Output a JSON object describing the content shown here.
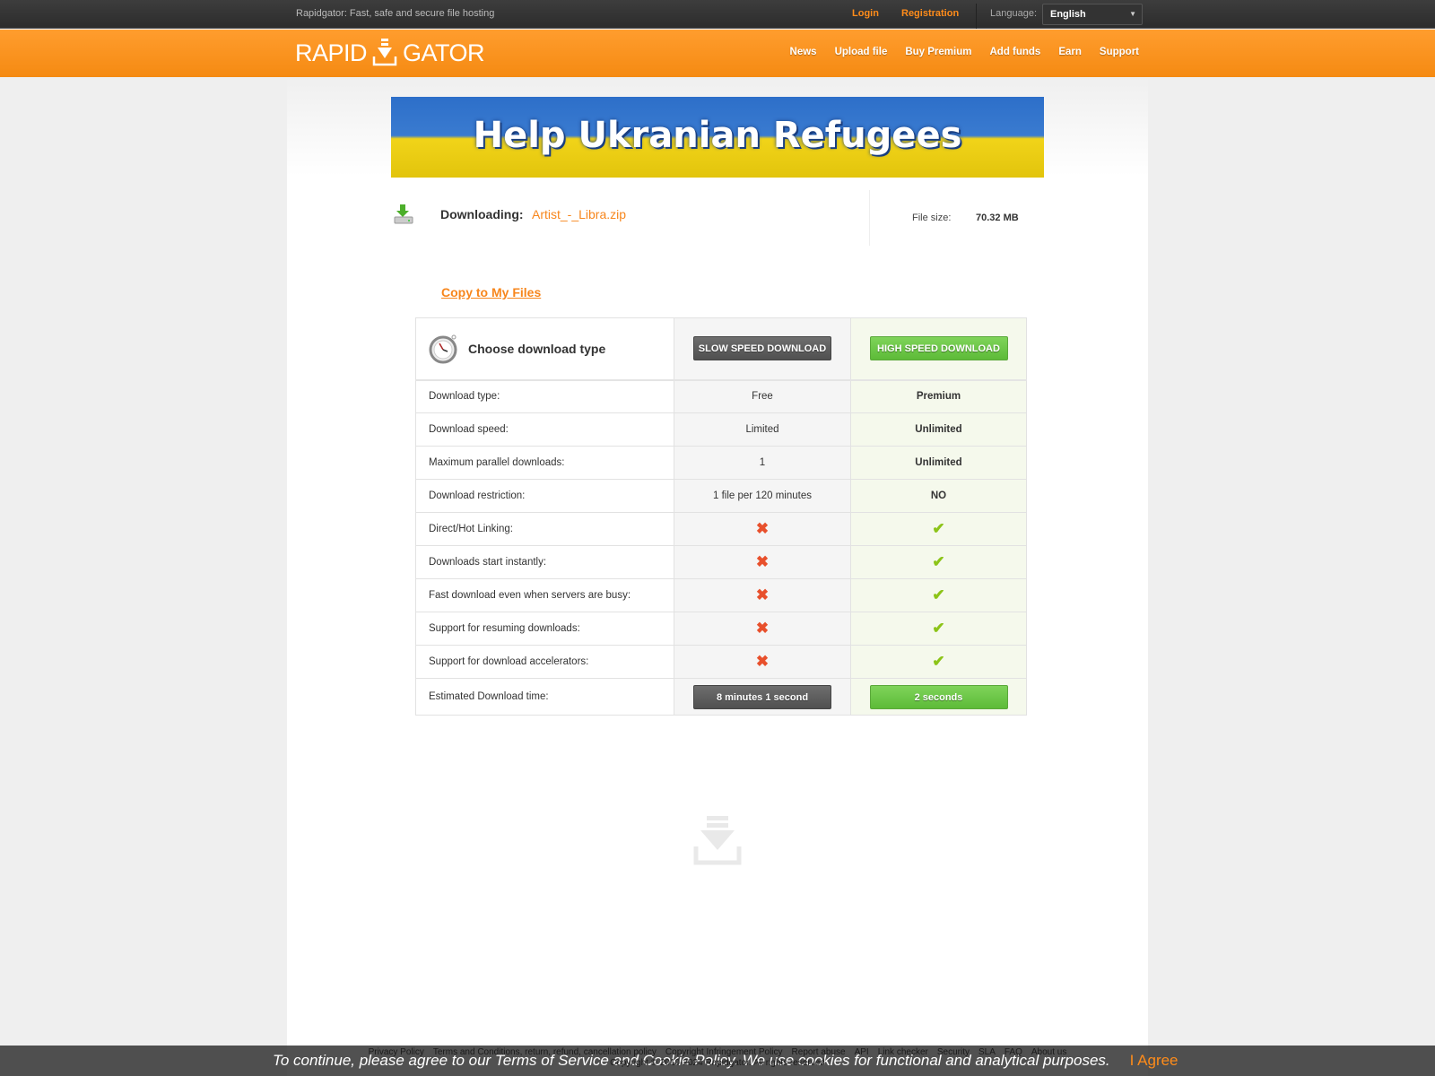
{
  "topbar": {
    "tagline": "Rapidgator: Fast, safe and secure file hosting",
    "login": "Login",
    "registration": "Registration",
    "language_label": "Language:",
    "language_value": "English"
  },
  "header": {
    "logo": "RAPID GATOR",
    "logo_left": "RAPID",
    "logo_right": "GATOR",
    "nav": [
      "News",
      "Upload file",
      "Buy Premium",
      "Add funds",
      "Earn",
      "Support"
    ]
  },
  "banner": {
    "text": "Help Ukranian Refugees"
  },
  "file": {
    "downloading_label": "Downloading:",
    "name": "Artist_-_Libra.zip",
    "size_label": "File size:",
    "size": "70.32 MB"
  },
  "copy_link": "Copy to My Files",
  "table": {
    "title": "Choose download type",
    "slow_button": "SLOW SPEED DOWNLOAD",
    "high_button": "HIGH SPEED DOWNLOAD",
    "rows": [
      {
        "label": "Download type:",
        "free": "Free",
        "premium": "Premium"
      },
      {
        "label": "Download speed:",
        "free": "Limited",
        "premium": "Unlimited"
      },
      {
        "label": "Maximum parallel downloads:",
        "free": "1",
        "premium": "Unlimited"
      },
      {
        "label": "Download restriction:",
        "free": "1 file per 120 minutes",
        "premium": "NO"
      },
      {
        "label": "Direct/Hot Linking:",
        "free": "cross-icon",
        "premium": "check-icon"
      },
      {
        "label": "Downloads start instantly:",
        "free": "cross-icon",
        "premium": "check-icon"
      },
      {
        "label": "Fast download even when servers are busy:",
        "free": "cross-icon",
        "premium": "check-icon"
      },
      {
        "label": "Support for resuming downloads:",
        "free": "cross-icon",
        "premium": "check-icon"
      },
      {
        "label": "Support for download accelerators:",
        "free": "cross-icon",
        "premium": "check-icon"
      }
    ],
    "estimate": {
      "label": "Estimated Download time:",
      "free": "8 minutes 1 second",
      "premium": "2 seconds"
    }
  },
  "footer": {
    "links": [
      "Privacy Policy",
      "Terms and Conditions, return, refund, cancellation policy",
      "Copyright Infringement Policy",
      "Report abuse",
      "API",
      "Link checker",
      "Security",
      "SLA",
      "FAQ",
      "About us"
    ],
    "copyright": "Copyright © 2010-2024 Rapidgator. All rights reserved"
  },
  "cookie": {
    "text": "To continue, please agree to our Terms of Service and Cookie Policy. We use cookies for functional and analytical purposes.",
    "agree": "I Agree"
  },
  "colors": {
    "accent": "#f7861c",
    "premium_green": "#6cc845",
    "cross": "#e8502c",
    "check": "#8cc418"
  }
}
